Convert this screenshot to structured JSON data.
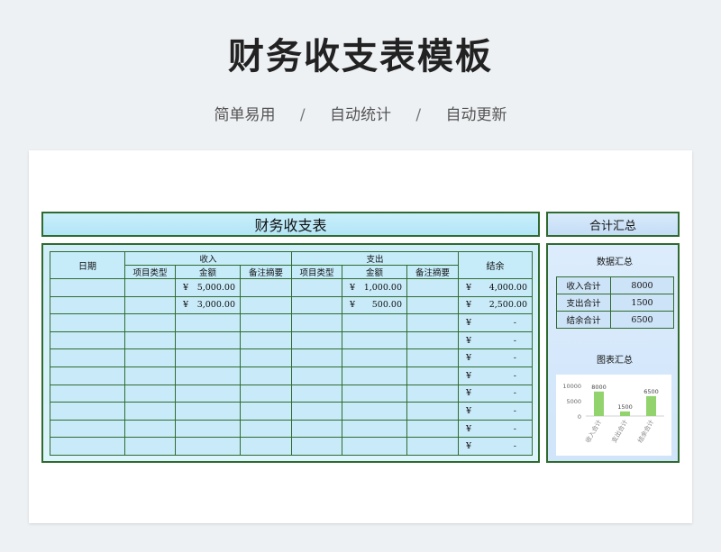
{
  "header": {
    "title": "财务收支表模板",
    "subtitle": [
      "简单易用",
      "自动统计",
      "自动更新"
    ],
    "separator": "/"
  },
  "ledger": {
    "title": "财务收支表",
    "headers": {
      "date": "日期",
      "income": "收入",
      "expense": "支出",
      "balance": "结余",
      "item_type": "项目类型",
      "amount": "金额",
      "note": "备注摘要"
    },
    "currency": "¥",
    "rows": [
      {
        "income_amount": "5,000.00",
        "expense_amount": "1,000.00",
        "balance": "4,000.00"
      },
      {
        "income_amount": "3,000.00",
        "expense_amount": "500.00",
        "balance": "2,500.00"
      },
      {
        "income_amount": "",
        "expense_amount": "",
        "balance": "-"
      },
      {
        "income_amount": "",
        "expense_amount": "",
        "balance": "-"
      },
      {
        "income_amount": "",
        "expense_amount": "",
        "balance": "-"
      },
      {
        "income_amount": "",
        "expense_amount": "",
        "balance": "-"
      },
      {
        "income_amount": "",
        "expense_amount": "",
        "balance": "-"
      },
      {
        "income_amount": "",
        "expense_amount": "",
        "balance": "-"
      },
      {
        "income_amount": "",
        "expense_amount": "",
        "balance": "-"
      },
      {
        "income_amount": "",
        "expense_amount": "",
        "balance": "-"
      }
    ]
  },
  "summary": {
    "banner": "合计汇总",
    "data_title": "数据汇总",
    "rows": [
      {
        "label": "收入合计",
        "value": "8000"
      },
      {
        "label": "支出合计",
        "value": "1500"
      },
      {
        "label": "结余合计",
        "value": "6500"
      }
    ],
    "chart_title": "图表汇总"
  },
  "chart_data": {
    "type": "bar",
    "title": "",
    "categories": [
      "收入合计",
      "支出合计",
      "结余合计"
    ],
    "values": [
      8000,
      1500,
      6500
    ],
    "ylim": [
      0,
      10000
    ],
    "yticks": [
      0,
      5000,
      10000
    ],
    "data_labels": true,
    "grid": false,
    "bar_color": "#92d36e",
    "axis_color": "#d0d0d0",
    "tick_label_color": "#666666"
  }
}
